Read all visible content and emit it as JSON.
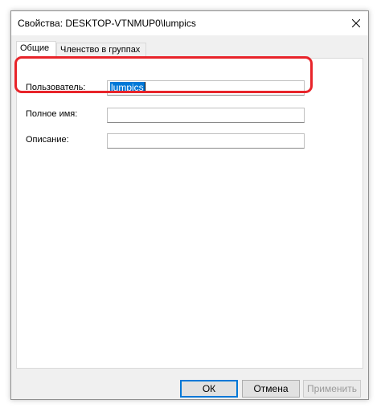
{
  "window": {
    "title": "Свойства: DESKTOP-VTNMUP0\\lumpics"
  },
  "tabs": [
    {
      "label": "Общие",
      "active": true
    },
    {
      "label": "Членство в группах",
      "active": false
    }
  ],
  "fields": {
    "username": {
      "label": "Пользователь:",
      "value": "lumpics"
    },
    "fullname": {
      "label": "Полное имя:",
      "value": ""
    },
    "description": {
      "label": "Описание:",
      "value": ""
    }
  },
  "buttons": {
    "ok": "ОК",
    "cancel": "Отмена",
    "apply": "Применить"
  },
  "colors": {
    "highlight": "#e8242a",
    "selection": "#0078d7"
  }
}
